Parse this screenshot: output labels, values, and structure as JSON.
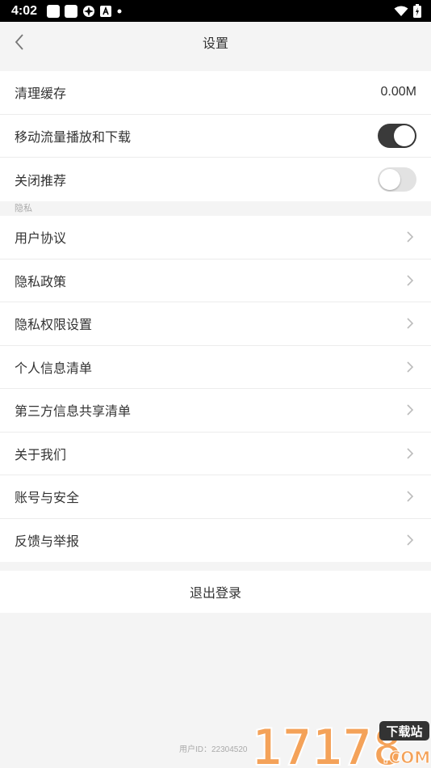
{
  "status_bar": {
    "time": "4:02",
    "icons": [
      "app-icon",
      "app-icon",
      "logo-icon",
      "a-icon",
      "dot-icon",
      "wifi-icon",
      "battery-charging-icon"
    ]
  },
  "header": {
    "title": "设置",
    "back_icon": "back-arrow-icon"
  },
  "settings": {
    "clear_cache": {
      "label": "清理缓存",
      "value": "0.00M"
    },
    "mobile_data": {
      "label": "移动流量播放和下载",
      "enabled": true
    },
    "disable_recommend": {
      "label": "关闭推荐",
      "enabled": false
    }
  },
  "privacy": {
    "group_label": "隐私",
    "items": [
      {
        "label": "用户协议"
      },
      {
        "label": "隐私政策"
      },
      {
        "label": "隐私权限设置"
      },
      {
        "label": "个人信息清单"
      },
      {
        "label": "第三方信息共享清单"
      },
      {
        "label": "关于我们"
      },
      {
        "label": "账号与安全"
      },
      {
        "label": "反馈与举报"
      }
    ]
  },
  "logout_label": "退出登录",
  "footer": {
    "user_id": "用户ID：22304520"
  },
  "watermark": {
    "number": "17178",
    "tag": "下载站",
    "domain": ".COM"
  },
  "colors": {
    "toggle_on": "#3a3a3a",
    "toggle_off": "#e2e2e2",
    "background": "#f4f4f4",
    "watermark": "#f4a259"
  }
}
